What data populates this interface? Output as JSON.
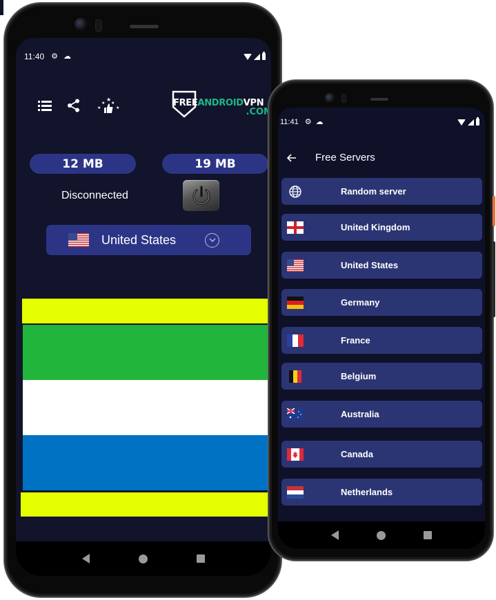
{
  "left_phone": {
    "status_bar": {
      "time": "11:40",
      "icons": [
        "gear-icon",
        "cloud-icon",
        "wifi-icon",
        "signal-icon",
        "battery-icon"
      ]
    },
    "toolbar": {
      "icons": [
        "menu-list-icon",
        "share-icon",
        "rate-thumbs-up-icon"
      ]
    },
    "logo": {
      "free": "FREE",
      "android": "ANDROID",
      "vpn": "VPN",
      "com": ".COM"
    },
    "download_pill": "12 MB",
    "upload_pill": "19 MB",
    "connection_status": "Disconnected",
    "power_button": "power-icon",
    "server_selector": {
      "flag": "us-flag",
      "label": "United States",
      "chevron": "chevron-down-circle-icon"
    },
    "banner_colors": [
      "#e6ff00",
      "#21b53b",
      "#ffffff",
      "#0072c4",
      "#e6ff00"
    ],
    "nav_bar": [
      "back",
      "home",
      "recents"
    ]
  },
  "right_phone": {
    "status_bar": {
      "time": "11:41",
      "icons": [
        "gear-icon",
        "cloud-icon",
        "wifi-icon",
        "signal-icon",
        "battery-icon"
      ]
    },
    "app_bar": {
      "back_icon": "back-arrow-icon",
      "title": "Free Servers"
    },
    "servers": [
      {
        "name": "Random server",
        "icon": "globe"
      },
      {
        "name": "United Kingdom",
        "icon": "gb-flag"
      },
      {
        "name": "United States",
        "icon": "us-flag"
      },
      {
        "name": "Germany",
        "icon": "de-flag"
      },
      {
        "name": "France",
        "icon": "fr-flag"
      },
      {
        "name": "Belgium",
        "icon": "be-flag"
      },
      {
        "name": "Australia",
        "icon": "au-flag"
      },
      {
        "name": "Canada",
        "icon": "ca-flag"
      },
      {
        "name": "Netherlands",
        "icon": "nl-flag"
      }
    ],
    "nav_bar": [
      "back",
      "home",
      "recents"
    ]
  },
  "colors": {
    "screen_bg": "#11142a",
    "pill_bg": "#2c3585",
    "list_item_bg": "#2c3573",
    "logo_accent": "#1fb58c"
  }
}
